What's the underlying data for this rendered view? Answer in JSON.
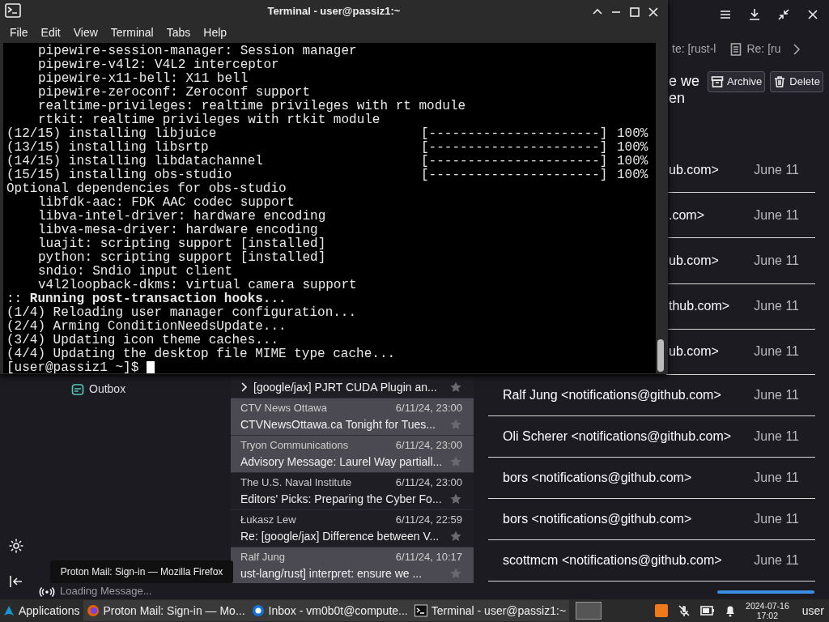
{
  "mail": {
    "tabs": [
      {
        "label": "te: [rust-l",
        "kind": "plain"
      },
      {
        "label": "Re: [ru",
        "kind": "message"
      }
    ],
    "subject_lines": [
      "e we",
      "en"
    ],
    "actions": [
      {
        "label": "Archive",
        "kind": "archive"
      },
      {
        "label": "Delete",
        "kind": "delete"
      }
    ],
    "folders": [
      {
        "label": "Outbox"
      }
    ],
    "thread_list": [
      {
        "kind": "thread",
        "subject": "[google/jax] PJRT CUDA Plugin an...",
        "highlighted": false
      },
      {
        "kind": "message",
        "sender": "CTV News Ottawa",
        "date": "6/11/24, 23:00",
        "subject": "CTVNewsOttawa.ca Tonight for Tues...",
        "highlighted": true
      },
      {
        "kind": "message",
        "sender": "Tryon Communications",
        "date": "6/11/24, 23:00",
        "subject": "Advisory Message: Laurel Way partiall...",
        "highlighted": true
      },
      {
        "kind": "message",
        "sender": "The U.S. Naval Institute",
        "date": "6/11/24, 23:00",
        "subject": "Editors' Picks: Preparing the Cyber Fo...",
        "highlighted": false
      },
      {
        "kind": "message",
        "sender": "Łukasz Lew",
        "date": "6/11/24, 22:59",
        "subject": "Re: [google/jax] Difference between V...",
        "highlighted": false
      },
      {
        "kind": "message",
        "sender": "Ralf Jung",
        "date": "6/11/24, 10:17",
        "subject": "ust-lang/rust] interpret: ensure we ...",
        "highlighted": true
      }
    ],
    "senders": [
      {
        "sender": "ub.com>",
        "date": "June 11",
        "partial": true
      },
      {
        "sender": ".com>",
        "date": "June 11",
        "partial": true
      },
      {
        "sender": "ub.com>",
        "date": "June 11",
        "partial": true
      },
      {
        "sender": "thub.com>",
        "date": "June 11",
        "partial": true
      },
      {
        "sender": "ub.com>",
        "date": "June 11",
        "partial": true
      },
      {
        "sender": "Ralf Jung <notifications@github.com>",
        "date": "June 11",
        "partial": false
      },
      {
        "sender": "Oli Scherer <notifications@github.com>",
        "date": "June 11",
        "partial": false
      },
      {
        "sender": "bors <notifications@github.com>",
        "date": "June 11",
        "partial": false
      },
      {
        "sender": "bors <notifications@github.com>",
        "date": "June 11",
        "partial": false
      },
      {
        "sender": "scottmcm <notifications@github.com>",
        "date": "June 11",
        "partial": false
      }
    ],
    "status_bar": {
      "text": "Loading Message...",
      "level": 1
    }
  },
  "terminal": {
    "title": "Terminal - user@passiz1:~",
    "menu": [
      "File",
      "Edit",
      "View",
      "Terminal",
      "Tabs",
      "Help"
    ],
    "lines": [
      {
        "kind": "indented",
        "text": "pipewire-session-manager: Session manager"
      },
      {
        "kind": "indented",
        "text": "pipewire-v4l2: V4L2 interceptor"
      },
      {
        "kind": "indented",
        "text": "pipewire-x11-bell: X11 bell"
      },
      {
        "kind": "indented",
        "text": "pipewire-zeroconf: Zeroconf support"
      },
      {
        "kind": "indented",
        "text": "realtime-privileges: realtime privileges with rt module"
      },
      {
        "kind": "indented",
        "text": "rtkit: realtime privileges with rtkit module"
      },
      {
        "kind": "progress",
        "text": "(12/15) installing libjuice",
        "bar": "[----------------------]",
        "percent": "100%"
      },
      {
        "kind": "progress",
        "text": "(13/15) installing libsrtp",
        "bar": "[----------------------]",
        "percent": "100%"
      },
      {
        "kind": "progress",
        "text": "(14/15) installing libdatachannel",
        "bar": "[----------------------]",
        "percent": "100%"
      },
      {
        "kind": "progress",
        "text": "(15/15) installing obs-studio",
        "bar": "[----------------------]",
        "percent": "100%"
      },
      {
        "kind": "plain",
        "text": "Optional dependencies for obs-studio"
      },
      {
        "kind": "indented",
        "text": "libfdk-aac: FDK AAC codec support"
      },
      {
        "kind": "indented",
        "text": "libva-intel-driver: hardware encoding"
      },
      {
        "kind": "indented",
        "text": "libva-mesa-driver: hardware encoding"
      },
      {
        "kind": "indented",
        "text": "luajit: scripting support [installed]"
      },
      {
        "kind": "indented",
        "text": "python: scripting support [installed]"
      },
      {
        "kind": "indented",
        "text": "sndio: Sndio input client"
      },
      {
        "kind": "indented",
        "text": "v4l2loopback-dkms: virtual camera support"
      },
      {
        "kind": "plain",
        "text": ":: **Running post-transaction hooks...**"
      },
      {
        "kind": "plain",
        "text": "(1/4) Reloading user manager configuration..."
      },
      {
        "kind": "plain",
        "text": "(2/4) Arming ConditionNeedsUpdate..."
      },
      {
        "kind": "plain",
        "text": "(3/4) Updating icon theme caches..."
      },
      {
        "kind": "plain",
        "text": "(4/4) Updating the desktop file MIME type cache..."
      }
    ],
    "prompt": "[user@passiz1 ~]$"
  },
  "tooltip": "Proton Mail: Sign-in — Mozilla Firefox",
  "taskbar": {
    "start": "Applications",
    "tasks": [
      {
        "kind": "firefox",
        "label": "Proton Mail: Sign-in — Mo..."
      },
      {
        "kind": "mail",
        "label": "Inbox - vm0b0t@compute..."
      },
      {
        "kind": "terminal",
        "label": "Terminal - user@passiz1:~"
      }
    ],
    "date": "2024-07-16",
    "time": "17:02",
    "user": "user"
  }
}
